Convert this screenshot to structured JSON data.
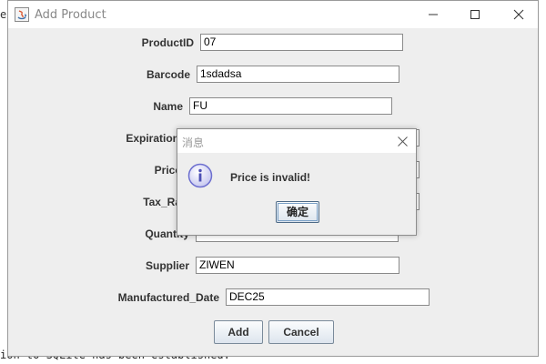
{
  "console": {
    "left_fragment": "e",
    "bottom_text": "ion to SQLite has been established."
  },
  "window": {
    "title": "Add Product",
    "minimize_glyph": "—",
    "maximize_glyph": "☐",
    "close_glyph": "✕"
  },
  "form": {
    "product_id": {
      "label": "ProductID",
      "value": "07"
    },
    "barcode": {
      "label": "Barcode",
      "value": "1sdadsa"
    },
    "name": {
      "label": "Name",
      "value": "FU"
    },
    "expiration": {
      "label": "Expiration",
      "value": ""
    },
    "price": {
      "label": "Price",
      "value": ""
    },
    "tax_rate": {
      "label": "Tax_Ra",
      "value": ""
    },
    "quantity": {
      "label": "Quantity",
      "value": ""
    },
    "supplier": {
      "label": "Supplier",
      "value": "ZIWEN"
    },
    "manufactured_date": {
      "label": "Manufactured_Date",
      "value": "DEC25"
    }
  },
  "buttons": {
    "add": "Add",
    "cancel": "Cancel"
  },
  "dialog": {
    "title": "消息",
    "close_glyph": "✕",
    "message": "Price is invalid!",
    "ok_label": "确定",
    "icon": "info-icon"
  },
  "colors": {
    "window_bg": "#eeeeee",
    "button_border": "#7a8a9a",
    "info_icon": "#6d6fcf"
  }
}
